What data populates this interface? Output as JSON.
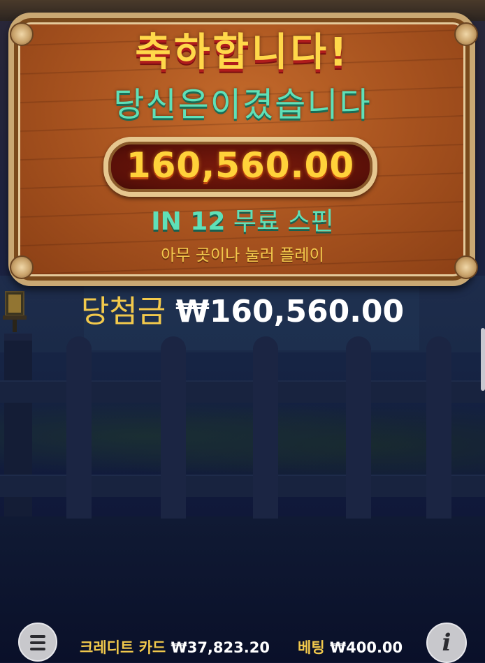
{
  "popup": {
    "title": "축하합니다!",
    "subtitle": "당신은이겼습니다",
    "amount": "160,560.00",
    "spins_prefix": "IN 12",
    "spins_suffix": "무료 스핀",
    "tap_hint": "아무 곳이나 눌러 플레이"
  },
  "win": {
    "label": "당첨금",
    "value": "₩160,560.00"
  },
  "bottom_bar": {
    "credit_label": "크레디트 카드",
    "credit_value": "₩37,823.20",
    "bet_label": "베팅",
    "bet_value": "₩400.00",
    "menu_icon": "hamburger-menu-icon",
    "info_icon": "info-icon",
    "info_glyph": "i"
  },
  "colors": {
    "title": "#ffd84a",
    "subtitle": "#5fe0b8",
    "label_gold": "#f2c94c",
    "board": "#a5511e"
  }
}
